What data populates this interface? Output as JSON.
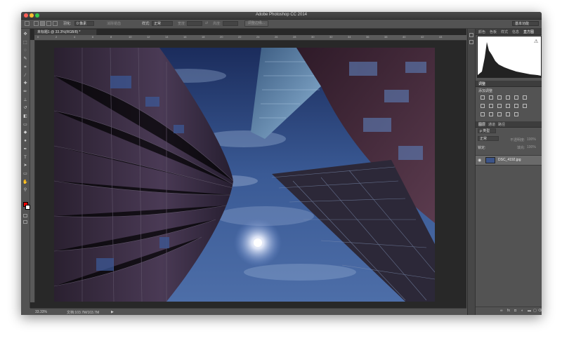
{
  "window": {
    "title": "Adobe Photoshop CC 2014"
  },
  "options_bar": {
    "feather_label": "羽化:",
    "feather_value": "0 像素",
    "antialias_label": "消除锯齿",
    "style_label": "样式:",
    "style_value": "正常",
    "width_label": "宽度:",
    "height_label": "高度:",
    "refine_edge_label": "调整边缘...",
    "workspace": "基本功能"
  },
  "document_tab": {
    "label": "未标题1 @ 33.3%(RGB/8) *"
  },
  "rulers": {
    "h_ticks": [
      "0",
      "2",
      "4",
      "6",
      "8",
      "10",
      "12",
      "14",
      "16",
      "18",
      "20",
      "22",
      "24",
      "26",
      "28",
      "30",
      "32",
      "34",
      "36",
      "38",
      "40",
      "42",
      "44"
    ]
  },
  "status_bar": {
    "zoom": "33.33%",
    "doc_size": "文档:103.7M/103.7M",
    "arrow": "▶"
  },
  "panels": {
    "top_tabs": [
      "颜色",
      "色板",
      "样式",
      "信息",
      "直方图"
    ],
    "active_top_tab": "直方图",
    "adjust_tab": "调整",
    "adjust_add_label": "添加调整",
    "layer_tabs": [
      "图层",
      "通道",
      "路径"
    ],
    "kind_label": "ρ 类型",
    "blend_mode": "正常",
    "opacity_label": "不透明度:",
    "opacity_value": "100%",
    "lock_label": "锁定:",
    "fill_label": "填充:",
    "fill_value": "100%",
    "layer_name": "DSC_4192.jpg"
  },
  "tools": [
    "move-icon",
    "marquee-icon",
    "lasso-icon",
    "quick-select-icon",
    "crop-icon",
    "eyedropper-icon",
    "heal-icon",
    "brush-icon",
    "stamp-icon",
    "history-brush-icon",
    "eraser-icon",
    "gradient-icon",
    "blur-icon",
    "dodge-icon",
    "pen-icon",
    "type-icon",
    "path-select-icon",
    "shape-icon",
    "hand-icon",
    "zoom-icon"
  ],
  "tool_glyphs": [
    "✥",
    "⬚",
    "◌",
    "✎",
    "⌗",
    "⁄",
    "✚",
    "✏",
    "⊥",
    "↺",
    "◧",
    "▭",
    "◆",
    "●",
    "✒",
    "T",
    "➤",
    "▭",
    "✋",
    "⚲"
  ],
  "colors": {
    "foreground": "#ff0000",
    "background": "#ffffff",
    "ui_dark": "#535353"
  }
}
